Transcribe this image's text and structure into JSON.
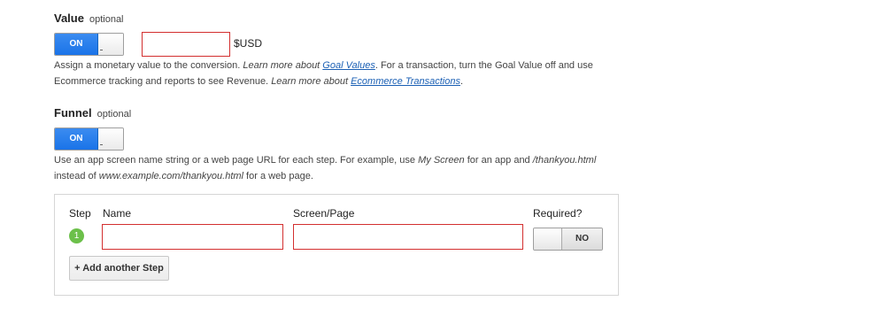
{
  "value_section": {
    "title": "Value",
    "optional": "optional",
    "toggle_label": "ON",
    "amount_value": "",
    "currency": "$USD",
    "help": {
      "t1": "Assign a monetary value to the conversion. ",
      "t2": "Learn more about ",
      "link1": "Goal Values",
      "t3": ". For a transaction, turn the Goal Value off and use",
      "t4": "Ecommerce tracking and reports to see Revenue. ",
      "t5": "Learn more about ",
      "link2": "Ecommerce Transactions",
      "t6": "."
    }
  },
  "funnel_section": {
    "title": "Funnel",
    "optional": "optional",
    "toggle_label": "ON",
    "help": {
      "t1": "Use an app screen name string or a web page URL for each step. For example, use ",
      "e1": "My Screen",
      "t2": " for an app and ",
      "e2": "/thankyou.html",
      "t3": "instead of ",
      "e3": "www.example.com/thankyou.html",
      "t4": " for a web page."
    },
    "table": {
      "headers": {
        "step": "Step",
        "name": "Name",
        "screen": "Screen/Page",
        "required": "Required?"
      },
      "rows": [
        {
          "step": "1",
          "name": "",
          "screen": "",
          "required": "NO"
        }
      ],
      "add_button": "+ Add another Step"
    }
  },
  "colors": {
    "accent": "#1a73e8",
    "error": "#d32f2f",
    "step_badge": "#6cc04a"
  }
}
